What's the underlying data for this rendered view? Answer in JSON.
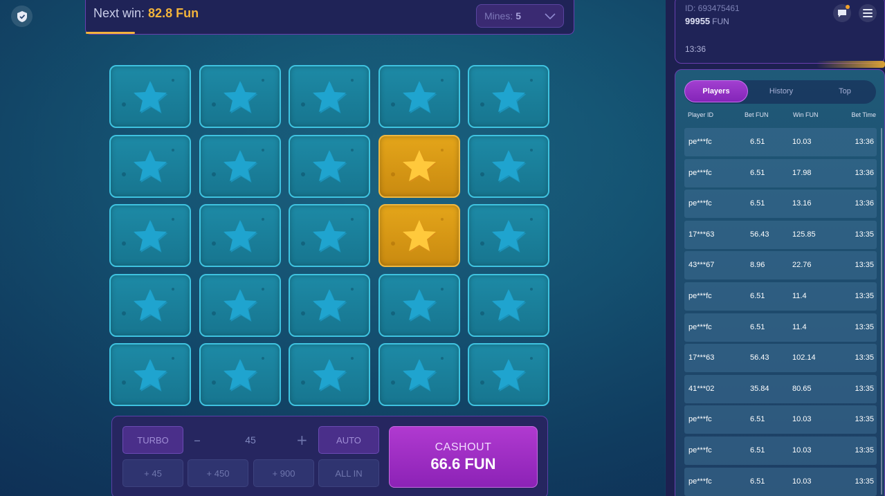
{
  "header": {
    "next_win_label": "Next win:",
    "next_win_value": "82.8 Fun",
    "progress_fraction": 0.1,
    "mines_label": "Mines:",
    "mines_value": "5"
  },
  "grid": {
    "rows": 5,
    "cols": 5,
    "revealed": [
      [
        1,
        3
      ],
      [
        2,
        3
      ]
    ],
    "colors": {
      "tile": "#1d8aa6",
      "tile_border": "#3fc3e0",
      "star": "#1fa4cf",
      "revealed_tile": "#e4a51a",
      "revealed_star": "#ffc93c"
    }
  },
  "controls": {
    "turbo_label": "TURBO",
    "bet_value": "45",
    "auto_label": "AUTO",
    "quick_bets": [
      "+ 45",
      "+ 450",
      "+ 900",
      "ALL IN"
    ],
    "cashout_label": "CASHOUT",
    "cashout_value": "66.6  FUN"
  },
  "account": {
    "id": "ID: 693475461",
    "balance": "99955",
    "currency": "FUN",
    "time": "13:36"
  },
  "bets": {
    "tabs": [
      "Players",
      "History",
      "Top"
    ],
    "active_tab": "Players",
    "columns": [
      "Player ID",
      "Bet  FUN",
      "Win  FUN",
      "Bet Time"
    ],
    "rows": [
      {
        "id": "pe***fc",
        "bet": "6.51",
        "win": "10.03",
        "time": "13:36"
      },
      {
        "id": "pe***fc",
        "bet": "6.51",
        "win": "17.98",
        "time": "13:36"
      },
      {
        "id": "pe***fc",
        "bet": "6.51",
        "win": "13.16",
        "time": "13:36"
      },
      {
        "id": "17***63",
        "bet": "56.43",
        "win": "125.85",
        "time": "13:35"
      },
      {
        "id": "43***67",
        "bet": "8.96",
        "win": "22.76",
        "time": "13:35"
      },
      {
        "id": "pe***fc",
        "bet": "6.51",
        "win": "11.4",
        "time": "13:35"
      },
      {
        "id": "pe***fc",
        "bet": "6.51",
        "win": "11.4",
        "time": "13:35"
      },
      {
        "id": "17***63",
        "bet": "56.43",
        "win": "102.14",
        "time": "13:35"
      },
      {
        "id": "41***02",
        "bet": "35.84",
        "win": "80.65",
        "time": "13:35"
      },
      {
        "id": "pe***fc",
        "bet": "6.51",
        "win": "10.03",
        "time": "13:35"
      },
      {
        "id": "pe***fc",
        "bet": "6.51",
        "win": "10.03",
        "time": "13:35"
      },
      {
        "id": "pe***fc",
        "bet": "6.51",
        "win": "10.03",
        "time": "13:35"
      }
    ]
  },
  "icons": {
    "shield": "shield-icon",
    "chevron": "chevron-down-icon",
    "chat": "chat-icon",
    "menu": "menu-icon",
    "star": "star-icon"
  }
}
